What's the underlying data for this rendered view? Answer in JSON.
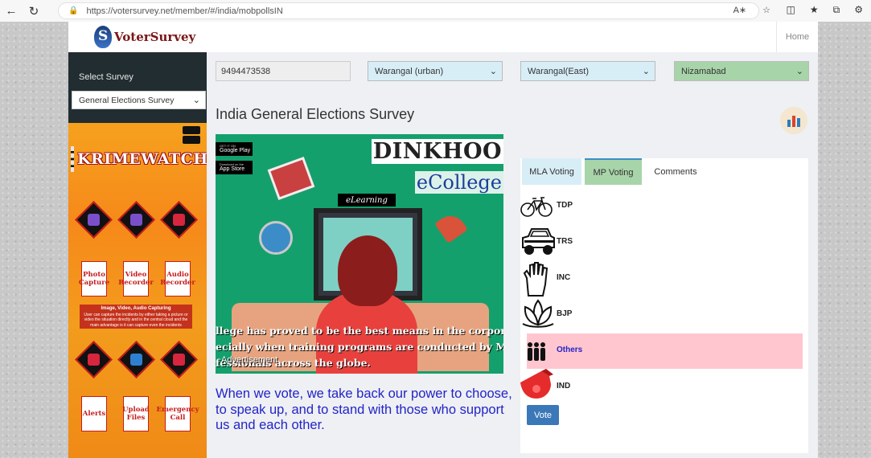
{
  "browser": {
    "url": "https://votersurvey.net/member/#/india/mobpollsIN",
    "icons": {
      "back": "back-arrow-icon",
      "reload": "reload-icon",
      "lock": "lock-icon"
    }
  },
  "brand": {
    "name": "VoterSurvey"
  },
  "nav": {
    "home": "Home"
  },
  "sidebar": {
    "select_label": "Select Survey",
    "survey_value": "General Elections Survey"
  },
  "krimewatch_ad": {
    "title": "KRIMEWATCH",
    "tiles": [
      "Photo Capture",
      "Video Recorder",
      "Audio Recorder",
      "Alerts",
      "Upload Files",
      "Emergency Call"
    ],
    "banner_title": "Image, Video, Audio Capturing",
    "banner_text": "User can capture the incidents by either taking a picture or video the situation directly and in the central cloud and the main advantage is it can capture even the incidents"
  },
  "filters": {
    "phone": "9494473538",
    "district": "Warangal (urban)",
    "constituency": "Warangal(East)",
    "mp_constituency": "Nizamabad"
  },
  "page_title": "India General Elections Survey",
  "ad": {
    "store1": "Google Play",
    "store1_small": "GET IT ON",
    "store2": "App Store",
    "store2_small": "Download on the",
    "brand": "DINKHOO",
    "sub": "eCollege",
    "badge": "eLearning",
    "caption": [
      "llege has proved to be the best means in the corporate sect",
      "ecially when training programs are conducted by MNCs for",
      "fessionals across the globe."
    ],
    "label": "Advertisement"
  },
  "quote": "When we vote, we take back our power to choose, to speak up, and to stand with those who support us and each other.",
  "voting": {
    "tabs": [
      "MLA Voting",
      "MP Voting",
      "Comments"
    ],
    "active_tab": "MP Voting",
    "parties": [
      {
        "name": "TDP",
        "symbol": "bicycle-icon"
      },
      {
        "name": "TRS",
        "symbol": "car-icon"
      },
      {
        "name": "INC",
        "symbol": "hand-icon"
      },
      {
        "name": "BJP",
        "symbol": "lotus-icon"
      },
      {
        "name": "Others",
        "symbol": "people-icon",
        "selected": true
      },
      {
        "name": "IND",
        "symbol": "whistle-icon"
      }
    ],
    "vote_button": "Vote"
  }
}
